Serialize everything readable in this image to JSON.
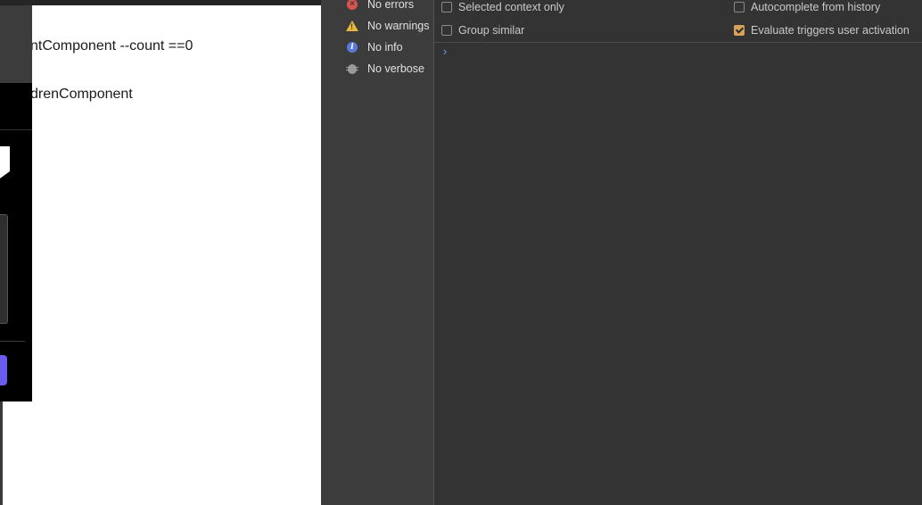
{
  "page": {
    "lines": [
      "ntComponent --count ==0",
      "drenComponent"
    ]
  },
  "sidebar": {
    "items": [
      {
        "icon": "error-icon",
        "label": "No errors",
        "color": "#d9534f"
      },
      {
        "icon": "warning-icon",
        "label": "No warnings",
        "color": "#e5b93a"
      },
      {
        "icon": "info-icon",
        "label": "No info",
        "color": "#5a79d8"
      },
      {
        "icon": "bug-icon",
        "label": "No verbose",
        "color": "#9a9a9a"
      }
    ]
  },
  "console": {
    "settings": [
      {
        "label": "Selected context only",
        "checked": false
      },
      {
        "label": "Autocomplete from history",
        "checked": false
      },
      {
        "label": "Group similar",
        "checked": false
      },
      {
        "label": "Evaluate triggers user activation",
        "checked": true
      }
    ],
    "prompt_symbol": "›",
    "accent": "#d6a25a"
  }
}
